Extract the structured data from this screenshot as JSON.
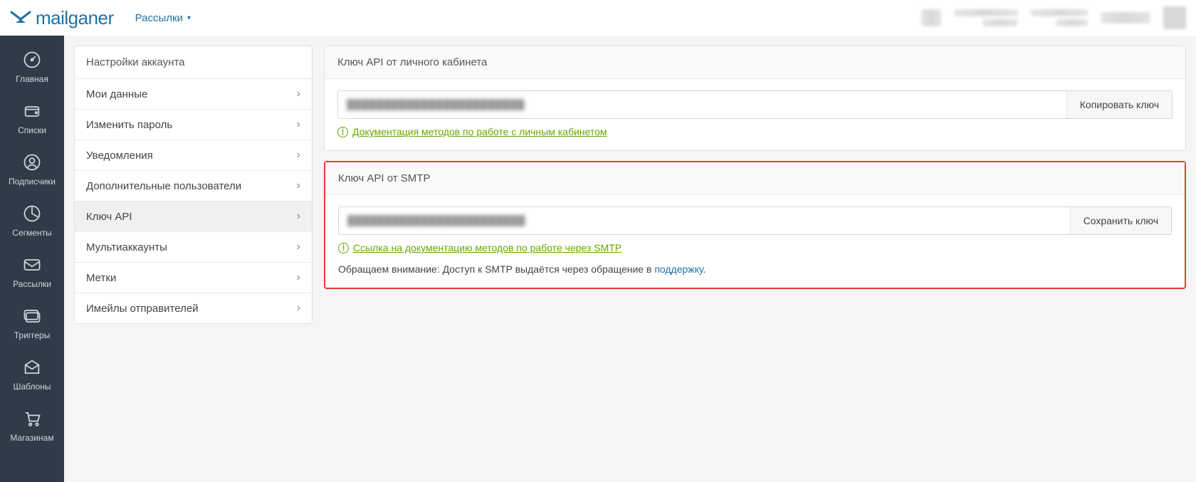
{
  "brand": "mailganer",
  "topnav": {
    "menu_label": "Рассылки"
  },
  "sidebar": {
    "items": [
      {
        "key": "home",
        "label": "Главная"
      },
      {
        "key": "lists",
        "label": "Списки"
      },
      {
        "key": "subscribers",
        "label": "Подписчики"
      },
      {
        "key": "segments",
        "label": "Сегменты"
      },
      {
        "key": "campaigns",
        "label": "Рассылки"
      },
      {
        "key": "triggers",
        "label": "Триггеры"
      },
      {
        "key": "templates",
        "label": "Шаблоны"
      },
      {
        "key": "shops",
        "label": "Магазинам"
      }
    ]
  },
  "settings_nav": {
    "title": "Настройки аккаунта",
    "items": [
      {
        "label": "Мои данные",
        "active": false
      },
      {
        "label": "Изменить пароль",
        "active": false
      },
      {
        "label": "Уведомления",
        "active": false
      },
      {
        "label": "Дополнительные пользователи",
        "active": false
      },
      {
        "label": "Ключ API",
        "active": true
      },
      {
        "label": "Мультиаккаунты",
        "active": false
      },
      {
        "label": "Метки",
        "active": false
      },
      {
        "label": "Имейлы отправителей",
        "active": false
      }
    ]
  },
  "api_personal": {
    "title": "Ключ API от личного кабинета",
    "key_masked": "████████████████████████",
    "copy_label": "Копировать ключ",
    "doc_label": "Документация методов по работе с личным кабинетом"
  },
  "api_smtp": {
    "title": "Ключ API от SMTP",
    "key_masked": "████████████████████████",
    "save_label": "Сохранить ключ",
    "doc_label": "Ссылка на документацию методов по работе через SMTP",
    "note_prefix": "Обращаем внимание: Доступ к SMTP выдаётся через обращение в ",
    "note_link": "поддержку",
    "note_suffix": "."
  }
}
